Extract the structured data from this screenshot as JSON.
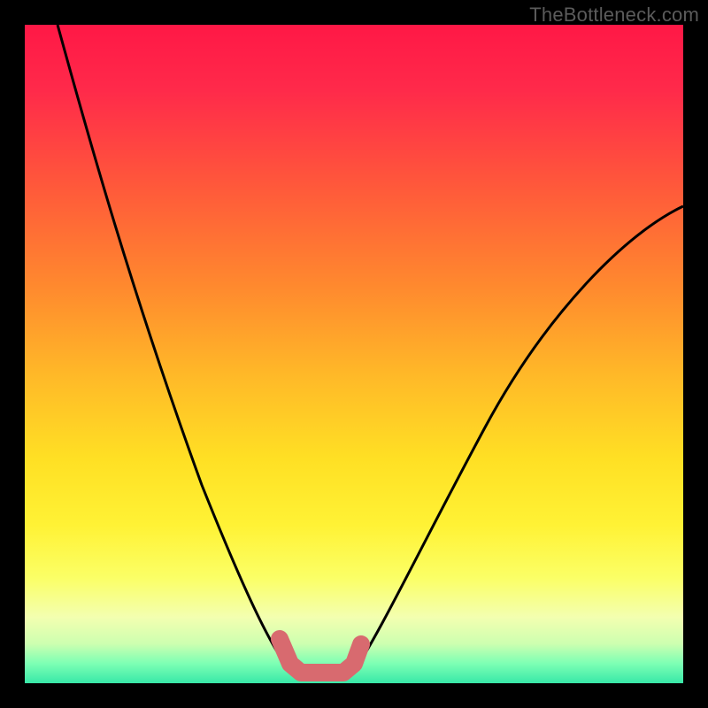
{
  "watermark": "TheBottleneck.com",
  "colors": {
    "background": "#000000",
    "curve": "#000000",
    "marker": "#d86a6f"
  },
  "chart_data": {
    "type": "line",
    "title": "",
    "xlabel": "",
    "ylabel": "",
    "xlim": [
      0,
      100
    ],
    "ylim": [
      0,
      100
    ],
    "series": [
      {
        "name": "left-curve",
        "x": [
          5,
          8,
          12,
          16,
          20,
          24,
          28,
          32,
          35,
          37,
          39,
          40
        ],
        "y": [
          100,
          88,
          73,
          59,
          46,
          34,
          23,
          14,
          8,
          5,
          3,
          2
        ]
      },
      {
        "name": "right-curve",
        "x": [
          50,
          53,
          57,
          62,
          68,
          75,
          82,
          90,
          100
        ],
        "y": [
          2,
          4,
          8,
          14,
          23,
          34,
          46,
          58,
          72
        ]
      },
      {
        "name": "valley-marker",
        "x": [
          38.5,
          40,
          42,
          44,
          46,
          48,
          49.5
        ],
        "y": [
          6,
          3,
          1.5,
          1.2,
          1.5,
          3,
          6
        ]
      }
    ]
  }
}
